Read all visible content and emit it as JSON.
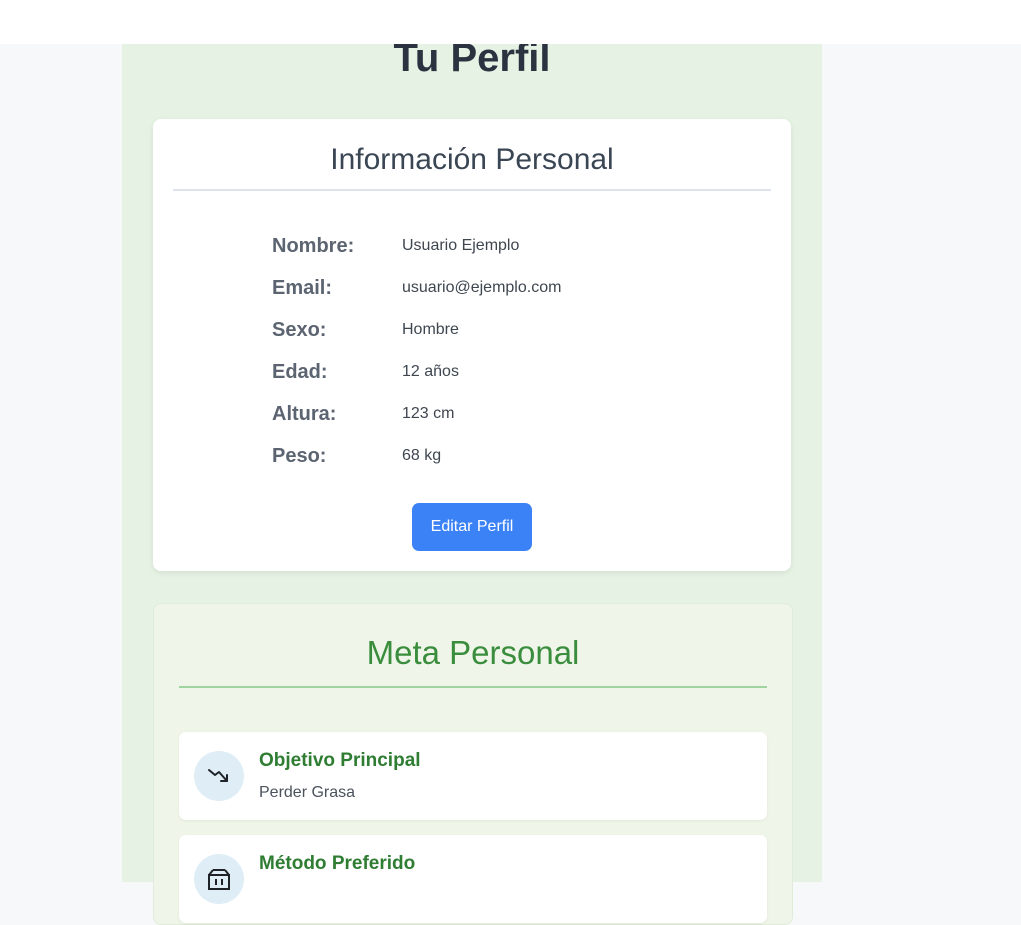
{
  "page": {
    "title": "Tu Perfil"
  },
  "personal_info": {
    "heading": "Información Personal",
    "rows": [
      {
        "label": "Nombre:",
        "value": "Usuario Ejemplo"
      },
      {
        "label": "Email:",
        "value": "usuario@ejemplo.com"
      },
      {
        "label": "Sexo:",
        "value": "Hombre"
      },
      {
        "label": "Edad:",
        "value": "12 años"
      },
      {
        "label": "Altura:",
        "value": "123 cm"
      },
      {
        "label": "Peso:",
        "value": "68 kg"
      }
    ],
    "edit_button_label": "Editar Perfil"
  },
  "goal": {
    "heading": "Meta Personal",
    "items": [
      {
        "title": "Objetivo Principal",
        "value": "Perder Grasa",
        "icon": "trending-down-icon"
      },
      {
        "title": "Método Preferido",
        "value": "",
        "icon": "gym-icon"
      }
    ]
  },
  "colors": {
    "panel_background": "#e6f2e4",
    "accent_blue": "#3b82f6",
    "accent_green": "#3b8d3e"
  }
}
